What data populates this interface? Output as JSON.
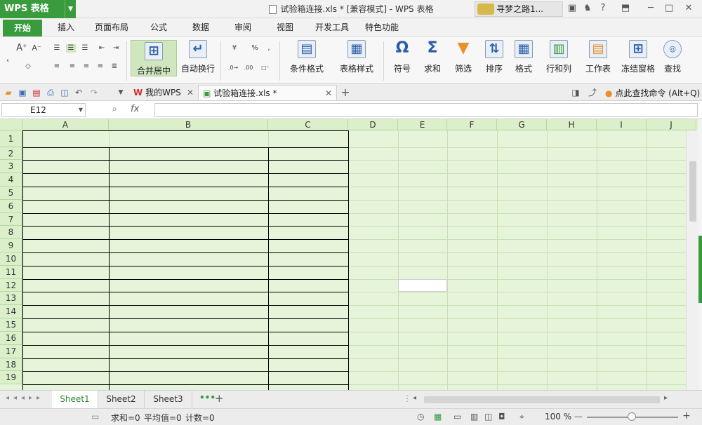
{
  "app": {
    "menu_label": "WPS 表格",
    "title": "试验箱连接.xls * [兼容模式] - WPS 表格",
    "user_name": "寻梦之路1..."
  },
  "tabs": [
    {
      "label": "开始",
      "active": true
    },
    {
      "label": "插入"
    },
    {
      "label": "页面布局"
    },
    {
      "label": "公式"
    },
    {
      "label": "数据"
    },
    {
      "label": "审阅"
    },
    {
      "label": "视图"
    },
    {
      "label": "开发工具"
    },
    {
      "label": "特色功能"
    }
  ],
  "ribbon": {
    "merge_center": "合并居中",
    "wrap_text": "自动换行",
    "conditional_format": "条件格式",
    "table_style": "表格样式",
    "symbol": "符号",
    "sum": "求和",
    "filter": "筛选",
    "sort": "排序",
    "format": "格式",
    "rows_cols": "行和列",
    "worksheet": "工作表",
    "freeze": "冻结窗格",
    "find": "查找"
  },
  "doc_tabs": {
    "my_wps": "我的WPS",
    "current_file": "试验箱连接.xls *"
  },
  "command_search": "点此查找命令 (Alt+Q)",
  "formula_bar": {
    "name_box": "E12",
    "fx": "fx",
    "formula": ""
  },
  "columns": [
    "A",
    "B",
    "C",
    "D",
    "E",
    "F",
    "G",
    "H",
    "I",
    "J"
  ],
  "rows": [
    "1",
    "2",
    "3",
    "4",
    "5",
    "6",
    "7",
    "8",
    "9",
    "10",
    "11",
    "12",
    "13",
    "14",
    "15",
    "16",
    "17",
    "18",
    "19"
  ],
  "sheets": [
    "Sheet1",
    "Sheet2",
    "Sheet3"
  ],
  "active_sheet": "Sheet1",
  "status": {
    "sum": "求和=0",
    "average": "平均值=0",
    "count": "计数=0",
    "zoom": "100 %"
  },
  "colors": {
    "accent": "#3a9b3e",
    "grid_bg": "#e6f5d9",
    "header_bg": "#dbefcb"
  }
}
